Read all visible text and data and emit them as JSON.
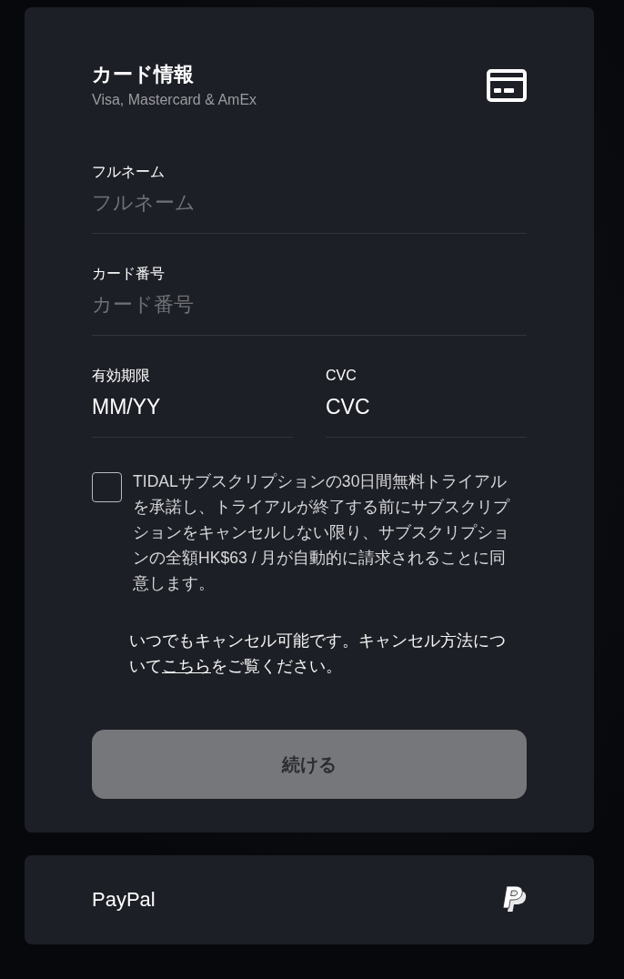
{
  "card_form": {
    "title": "カード情報",
    "subtitle": "Visa, Mastercard & AmEx",
    "fields": [
      {
        "label": "フルネーム",
        "placeholder": "フルネーム"
      },
      {
        "label": "カード番号",
        "placeholder": "カード番号"
      }
    ],
    "split_fields": [
      {
        "label": "有効期限",
        "value": "MM/YY"
      },
      {
        "label": "CVC",
        "value": "CVC"
      }
    ],
    "consent": {
      "checked": false,
      "text": "TIDALサブスクリプションの30日間無料トライアルを承諾し、トライアルが終了する前にサブスクリプションをキャンセルしない限り、サブスクリプションの全額HK$63 / 月が自動的に請求されることに同意します。"
    },
    "note": {
      "text_before": "いつでもキャンセル可能です。キャンセル方法について",
      "link": "こちら",
      "text_after": "をご覧ください。"
    },
    "continue_button": {
      "label": "続ける",
      "disabled": true
    }
  },
  "paypal_option": {
    "label": "PayPal"
  }
}
